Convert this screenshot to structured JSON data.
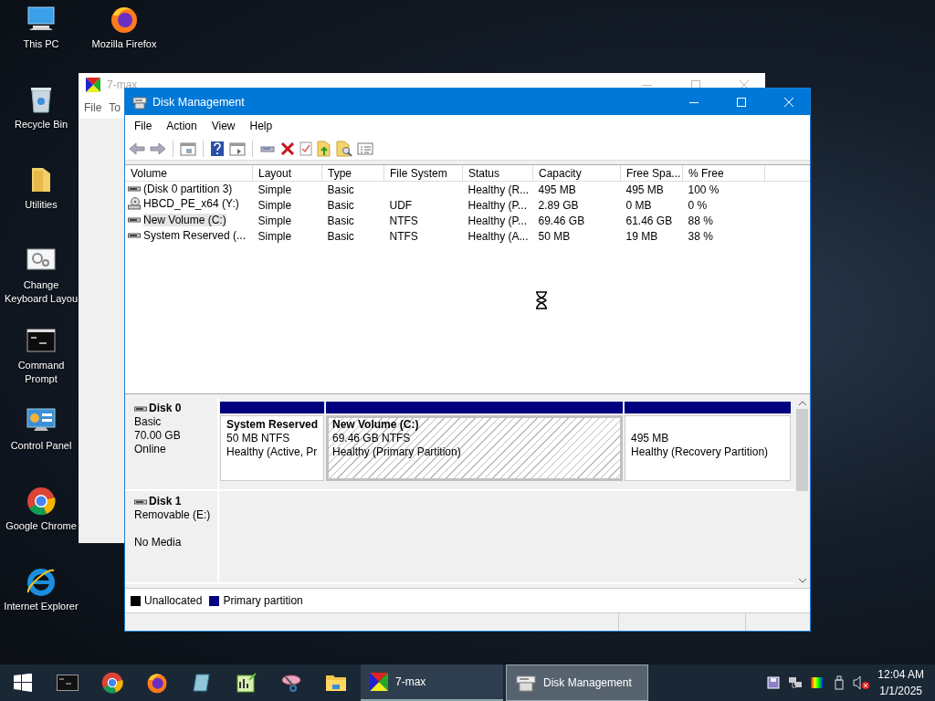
{
  "desktop_icons": [
    {
      "label": "This PC"
    },
    {
      "label": "Mozilla Firefox"
    },
    {
      "label": "Recycle Bin"
    },
    {
      "label": "Utilities"
    },
    {
      "label": "Change Keyboard Layou"
    },
    {
      "label": "Command Prompt"
    },
    {
      "label": "Control Panel"
    },
    {
      "label": "Google Chrome"
    },
    {
      "label": "Internet Explorer"
    }
  ],
  "background_window": {
    "title": "7-max",
    "menu": [
      "File",
      "To"
    ]
  },
  "window": {
    "title": "Disk Management",
    "menu": [
      "File",
      "Action",
      "View",
      "Help"
    ],
    "table": {
      "columns": [
        "Volume",
        "Layout",
        "Type",
        "File System",
        "Status",
        "Capacity",
        "Free Spa...",
        "% Free"
      ],
      "rows": [
        {
          "kind": "drive",
          "selected": false,
          "volume": "(Disk 0 partition 3)",
          "layout": "Simple",
          "type": "Basic",
          "status": "Healthy (R...",
          "capacity": "495 MB",
          "free_space": "495 MB",
          "percent_free": "100 %"
        },
        {
          "kind": "optical",
          "selected": false,
          "volume": "HBCD_PE_x64 (Y:)",
          "layout": "Simple",
          "type": "Basic",
          "file_system": "UDF",
          "status": "Healthy (P...",
          "capacity": "2.89 GB",
          "free_space": "0 MB",
          "percent_free": "0 %"
        },
        {
          "kind": "drive",
          "selected": true,
          "volume": "New Volume (C:)",
          "layout": "Simple",
          "type": "Basic",
          "file_system": "NTFS",
          "status": "Healthy (P...",
          "capacity": "69.46 GB",
          "free_space": "61.46 GB",
          "percent_free": "88 %"
        },
        {
          "kind": "drive",
          "selected": false,
          "volume": "System Reserved (...",
          "layout": "Simple",
          "type": "Basic",
          "file_system": "NTFS",
          "status": "Healthy (A...",
          "capacity": "50 MB",
          "free_space": "19 MB",
          "percent_free": "38 %"
        }
      ]
    },
    "disks": [
      {
        "name": "Disk 0",
        "type": "Basic",
        "size": "70.00 GB",
        "status": "Online",
        "partitions": [
          {
            "kind": "primary",
            "title": "System Reserved",
            "size": "50 MB NTFS",
            "status": "Healthy (Active, Pr",
            "selected": false
          },
          {
            "kind": "primary",
            "title": "New Volume  (C:)",
            "size": "69.46 GB NTFS",
            "status": "Healthy (Primary Partition)",
            "selected": true
          },
          {
            "kind": "primary",
            "size": "495 MB",
            "status": "Healthy (Recovery Partition)",
            "selected": false
          }
        ]
      },
      {
        "name": "Disk 1",
        "type": "Removable (E:)",
        "status": "No Media"
      }
    ],
    "legend": [
      {
        "label": "Unallocated",
        "color": "#000000"
      },
      {
        "label": "Primary partition",
        "color": "#000080"
      }
    ]
  },
  "taskbar": {
    "windows": [
      {
        "title": "7-max",
        "selected": false
      },
      {
        "title": "Disk Management",
        "selected": true
      }
    ],
    "time": "12:04 AM",
    "date": "1/1/2025"
  }
}
